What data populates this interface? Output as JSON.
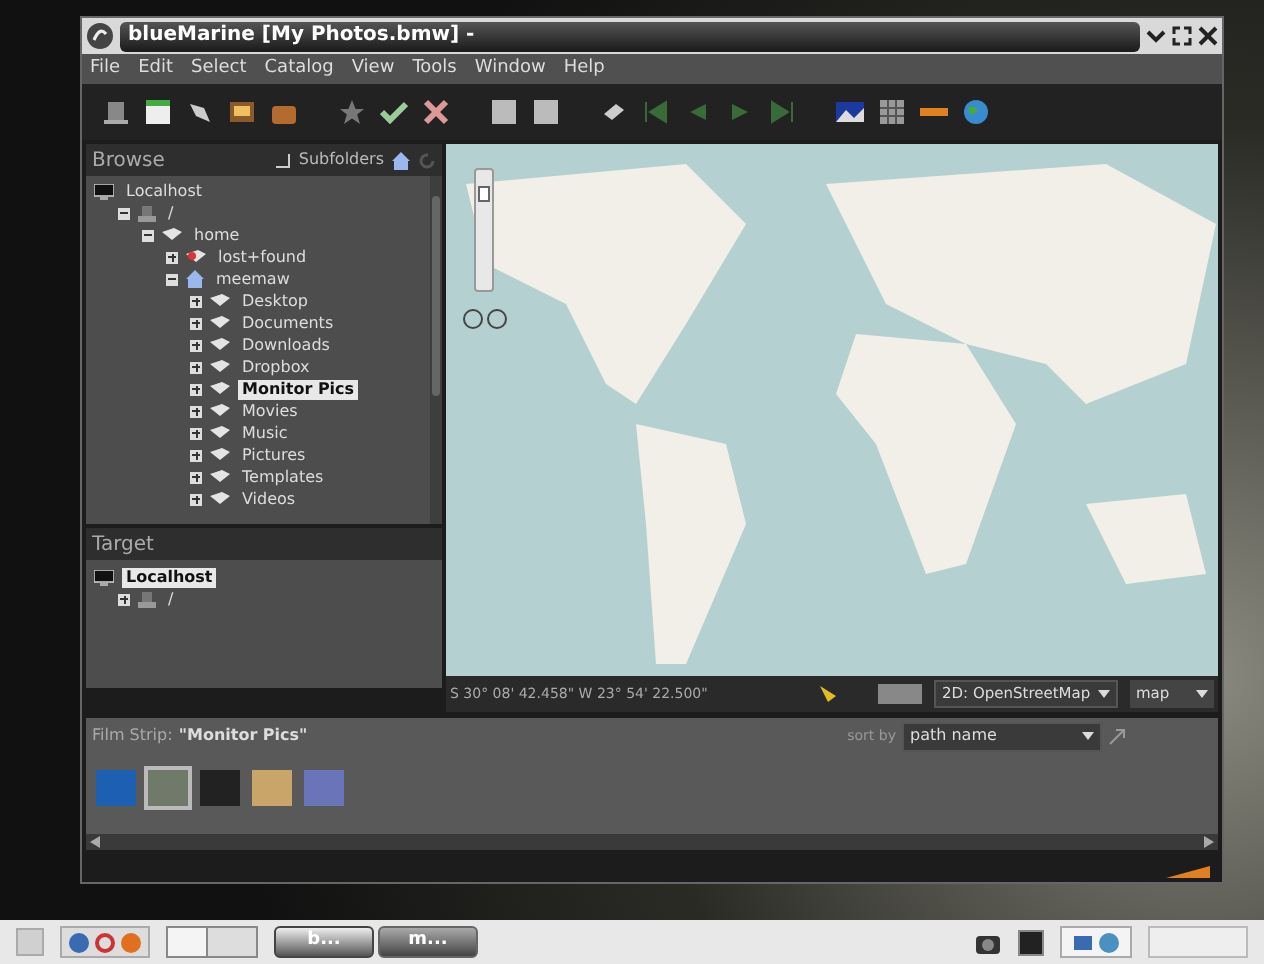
{
  "window": {
    "title": "blueMarine [My Photos.bmw] -"
  },
  "menu": [
    "File",
    "Edit",
    "Select",
    "Catalog",
    "View",
    "Tools",
    "Window",
    "Help"
  ],
  "browse": {
    "title": "Browse",
    "subfolders": {
      "label": "Subfolders",
      "checked": false
    },
    "tree": [
      {
        "label": "Localhost",
        "kind": "computer",
        "selected": false,
        "children": [
          {
            "label": "/",
            "kind": "drive",
            "expanded": true,
            "selected": false,
            "children": [
              {
                "label": "home",
                "kind": "folder",
                "expanded": true,
                "selected": false,
                "children": [
                  {
                    "label": "lost+found",
                    "kind": "locked",
                    "expanded": false,
                    "selected": false
                  },
                  {
                    "label": "meemaw",
                    "kind": "home",
                    "expanded": true,
                    "selected": false,
                    "children": [
                      {
                        "label": "Desktop",
                        "kind": "folder",
                        "expanded": false,
                        "selected": false
                      },
                      {
                        "label": "Documents",
                        "kind": "folder",
                        "expanded": false,
                        "selected": false
                      },
                      {
                        "label": "Downloads",
                        "kind": "folder",
                        "expanded": false,
                        "selected": false
                      },
                      {
                        "label": "Dropbox",
                        "kind": "folder",
                        "expanded": false,
                        "selected": false
                      },
                      {
                        "label": "Monitor Pics",
                        "kind": "folder",
                        "expanded": false,
                        "selected": true
                      },
                      {
                        "label": "Movies",
                        "kind": "folder",
                        "expanded": false,
                        "selected": false
                      },
                      {
                        "label": "Music",
                        "kind": "folder",
                        "expanded": false,
                        "selected": false
                      },
                      {
                        "label": "Pictures",
                        "kind": "folder",
                        "expanded": false,
                        "selected": false
                      },
                      {
                        "label": "Templates",
                        "kind": "folder",
                        "expanded": false,
                        "selected": false
                      },
                      {
                        "label": "Videos",
                        "kind": "folder",
                        "expanded": false,
                        "selected": false
                      }
                    ]
                  }
                ]
              }
            ]
          }
        ]
      }
    ]
  },
  "target": {
    "title": "Target",
    "tree": [
      {
        "label": "Localhost",
        "kind": "computer",
        "selected": true,
        "children": [
          {
            "label": "/",
            "kind": "drive",
            "expanded": false,
            "selected": false
          }
        ]
      }
    ]
  },
  "map": {
    "zoom": {
      "level": 0.85
    },
    "coordinates": "S 30° 08' 42.458\" W 23° 54' 22.500\"",
    "provider": "2D: OpenStreetMap",
    "mode": "map"
  },
  "film_strip": {
    "label": "Film Strip:",
    "folder": "\"Monitor Pics\"",
    "sort_label": "sort by",
    "sort": "path name",
    "thumbnails": [
      {
        "color": "#1d5fb0",
        "selected": false
      },
      {
        "color": "#6f7a6a",
        "selected": true
      },
      {
        "color": "#222222",
        "selected": false
      },
      {
        "color": "#c9a56a",
        "selected": false
      },
      {
        "color": "#6a74b8",
        "selected": false
      }
    ]
  },
  "taskbar": {
    "tasks": [
      {
        "label": "b...",
        "selected": true
      },
      {
        "label": "m...",
        "selected": false
      }
    ]
  }
}
